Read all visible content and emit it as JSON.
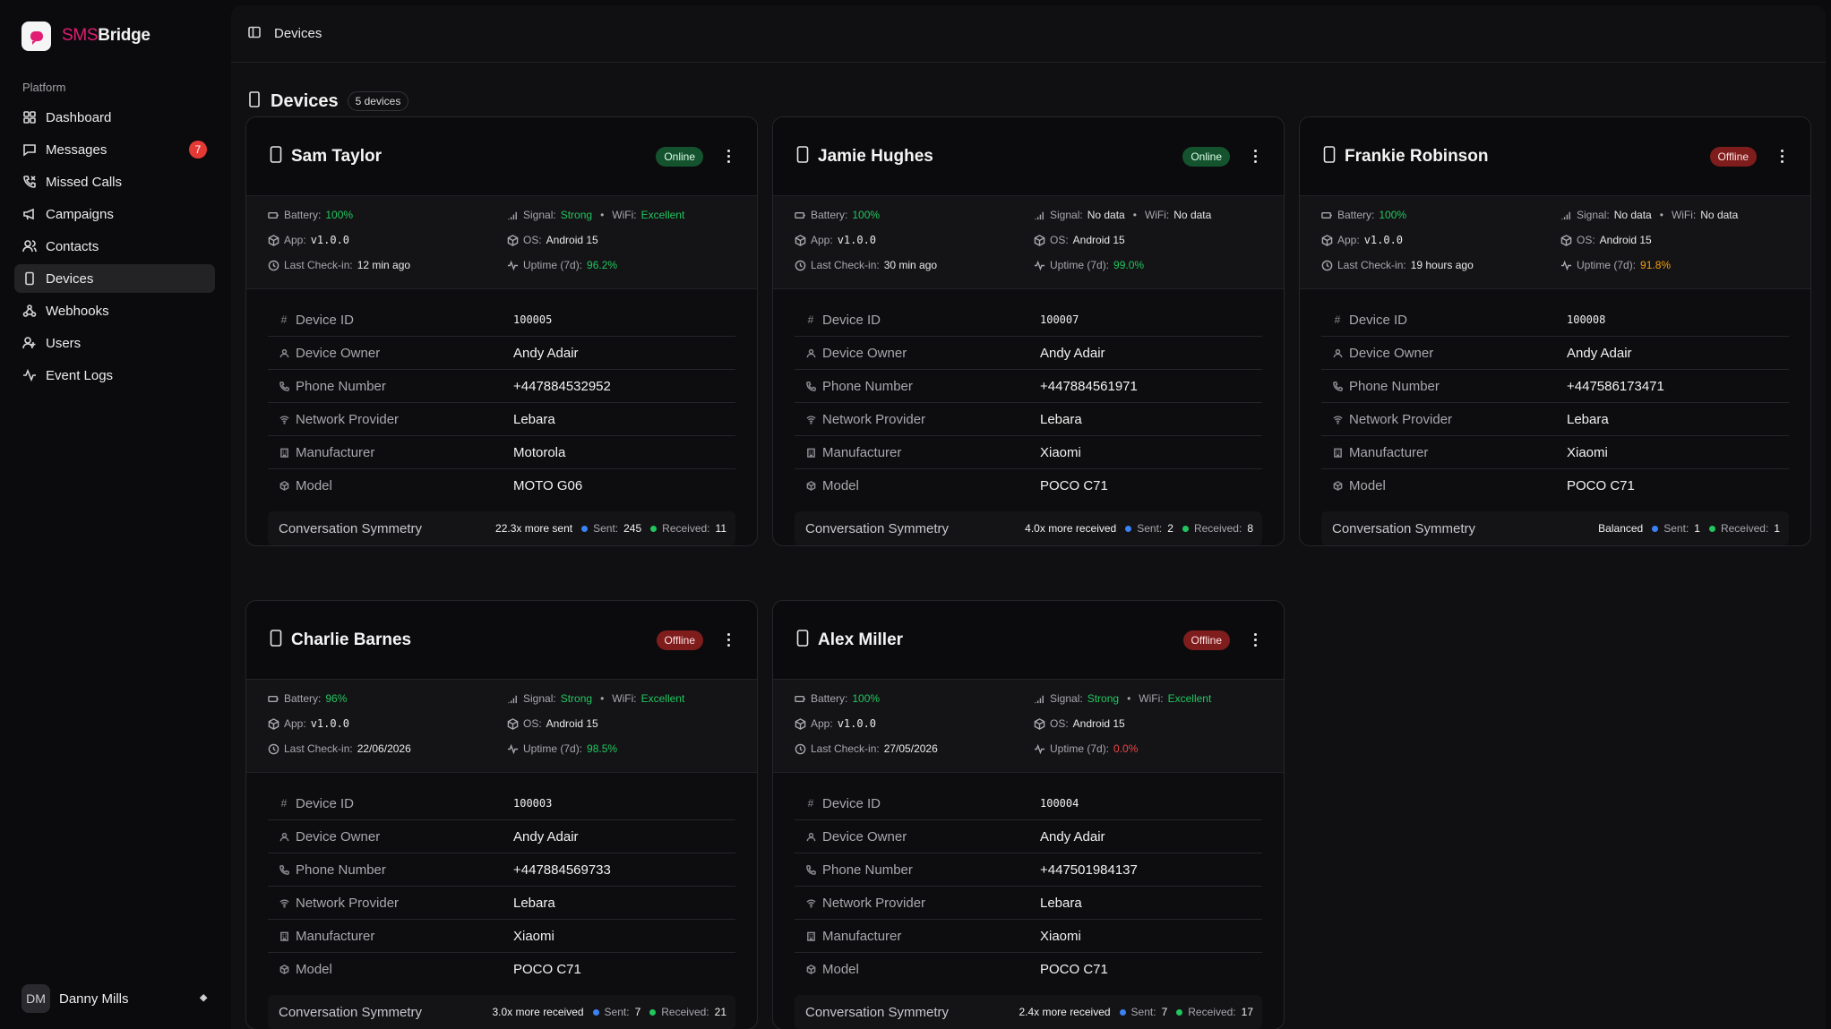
{
  "brand": {
    "prefix": "SMS",
    "suffix": "Bridge"
  },
  "sidebar": {
    "section": "Platform",
    "items": [
      {
        "label": "Dashboard",
        "icon": "grid-icon"
      },
      {
        "label": "Messages",
        "icon": "message-icon",
        "badge": "7"
      },
      {
        "label": "Missed Calls",
        "icon": "phone-missed-icon"
      },
      {
        "label": "Campaigns",
        "icon": "megaphone-icon"
      },
      {
        "label": "Contacts",
        "icon": "contacts-icon"
      },
      {
        "label": "Devices",
        "icon": "device-icon",
        "active": true
      },
      {
        "label": "Webhooks",
        "icon": "webhook-icon"
      },
      {
        "label": "Users",
        "icon": "users-icon"
      },
      {
        "label": "Event Logs",
        "icon": "activity-icon"
      }
    ],
    "user": {
      "initials": "DM",
      "name": "Danny Mills"
    }
  },
  "topbar": {
    "breadcrumb": "Devices"
  },
  "page": {
    "title": "Devices",
    "count": "5 devices"
  },
  "labels": {
    "battery": "Battery:",
    "signal": "Signal:",
    "wifi": "WiFi:",
    "app": "App:",
    "os": "OS:",
    "checkin": "Last Check-in:",
    "uptime": "Uptime (7d):",
    "device_id": "Device ID",
    "owner": "Device Owner",
    "phone": "Phone Number",
    "network": "Network Provider",
    "manufacturer": "Manufacturer",
    "model": "Model",
    "symmetry": "Conversation Symmetry",
    "sent": "Sent:",
    "received": "Received:"
  },
  "devices": [
    {
      "name": "Sam Taylor",
      "status": "Online",
      "battery": "100%",
      "signal": "Strong",
      "wifi": "Excellent",
      "app": "v1.0.0",
      "os": "Android 15",
      "checkin": "12 min ago",
      "uptime": "96.2%",
      "device_id": "100005",
      "owner": "Andy Adair",
      "phone": "+447884532952",
      "network": "Lebara",
      "manufacturer": "Motorola",
      "model": "MOTO G06",
      "sym": "22.3x more sent",
      "sent": "245",
      "received": "11"
    },
    {
      "name": "Jamie Hughes",
      "status": "Online",
      "battery": "100%",
      "signal": "No data",
      "wifi": "No data",
      "app": "v1.0.0",
      "os": "Android 15",
      "checkin": "30 min ago",
      "uptime": "99.0%",
      "device_id": "100007",
      "owner": "Andy Adair",
      "phone": "+447884561971",
      "network": "Lebara",
      "manufacturer": "Xiaomi",
      "model": "POCO C71",
      "sym": "4.0x more received",
      "sent": "2",
      "received": "8"
    },
    {
      "name": "Frankie Robinson",
      "status": "Offline",
      "battery": "100%",
      "signal": "No data",
      "wifi": "No data",
      "app": "v1.0.0",
      "os": "Android 15",
      "checkin": "19 hours ago",
      "uptime": "91.8%",
      "device_id": "100008",
      "owner": "Andy Adair",
      "phone": "+447586173471",
      "network": "Lebara",
      "manufacturer": "Xiaomi",
      "model": "POCO C71",
      "sym": "Balanced",
      "sent": "1",
      "received": "1"
    },
    {
      "name": "Charlie Barnes",
      "status": "Offline",
      "battery": "96%",
      "signal": "Strong",
      "wifi": "Excellent",
      "app": "v1.0.0",
      "os": "Android 15",
      "checkin": "22/06/2026",
      "uptime": "98.5%",
      "device_id": "100003",
      "owner": "Andy Adair",
      "phone": "+447884569733",
      "network": "Lebara",
      "manufacturer": "Xiaomi",
      "model": "POCO C71",
      "sym": "3.0x more received",
      "sent": "7",
      "received": "21"
    },
    {
      "name": "Alex Miller",
      "status": "Offline",
      "battery": "100%",
      "signal": "Strong",
      "wifi": "Excellent",
      "app": "v1.0.0",
      "os": "Android 15",
      "checkin": "27/05/2026",
      "uptime": "0.0%",
      "device_id": "100004",
      "owner": "Andy Adair",
      "phone": "+447501984137",
      "network": "Lebara",
      "manufacturer": "Xiaomi",
      "model": "POCO C71",
      "sym": "2.4x more received",
      "sent": "7",
      "received": "17"
    }
  ],
  "colors": {
    "accent": "#e11d74",
    "online": "#14532d",
    "offline": "#7f1d1d",
    "good": "#22c55e",
    "warn": "#f59e0b",
    "bad": "#ef4444"
  }
}
